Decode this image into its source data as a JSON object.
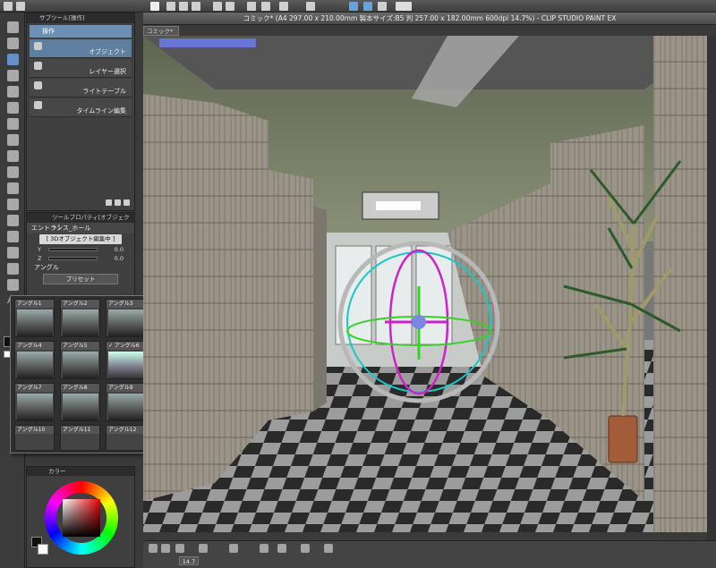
{
  "window": {
    "title": "コミック* (A4 297.00 x 210.00mm 製本サイズ:B5 判 257.00 x 182.00mm 600dpi 14.7%)  - CLIP STUDIO PAINT EX",
    "doc_tab": "コミック*"
  },
  "subtool_panel": {
    "header": "サブツール[操作]",
    "tab_label": "操作",
    "items": [
      {
        "label": "オブジェクト",
        "selected": true
      },
      {
        "label": "レイヤー選択",
        "selected": false
      },
      {
        "label": "ライトテーブル",
        "selected": false
      },
      {
        "label": "タイムライン編集",
        "selected": false
      }
    ]
  },
  "tool_property": {
    "header": "ツールプロパティ[オブジェクト]",
    "object_name": "エントランス_ホール",
    "edit_mode_label": "[ 3Dオブジェクト編集中 ]",
    "rows": [
      {
        "axis": "Y",
        "value": "0.0"
      },
      {
        "axis": "Z",
        "value": "0.0"
      }
    ],
    "angle_label": "アングル",
    "preset_label": "プリセット"
  },
  "presets": [
    {
      "label": "アングル1",
      "selected": false
    },
    {
      "label": "アングル2",
      "selected": false
    },
    {
      "label": "アングル3",
      "selected": false
    },
    {
      "label": "アングル4",
      "selected": false
    },
    {
      "label": "アングル5",
      "selected": false
    },
    {
      "label": "✓ アングル6",
      "selected": true
    },
    {
      "label": "アングル7",
      "selected": false
    },
    {
      "label": "アングル8",
      "selected": false
    },
    {
      "label": "アングル9",
      "selected": false
    },
    {
      "label": "アングル10",
      "selected": false
    },
    {
      "label": "アングル11",
      "selected": false
    },
    {
      "label": "アングル12",
      "selected": false
    }
  ],
  "color_panel": {
    "header": "カラー",
    "hue_color": "#ee0000"
  },
  "status": {
    "zoom": "14.7"
  },
  "colors": {
    "accent": "#6b8fb5",
    "gizmo_cyan": "#18c8c8",
    "gizmo_magenta": "#d020c8",
    "gizmo_green": "#3ad02a"
  }
}
